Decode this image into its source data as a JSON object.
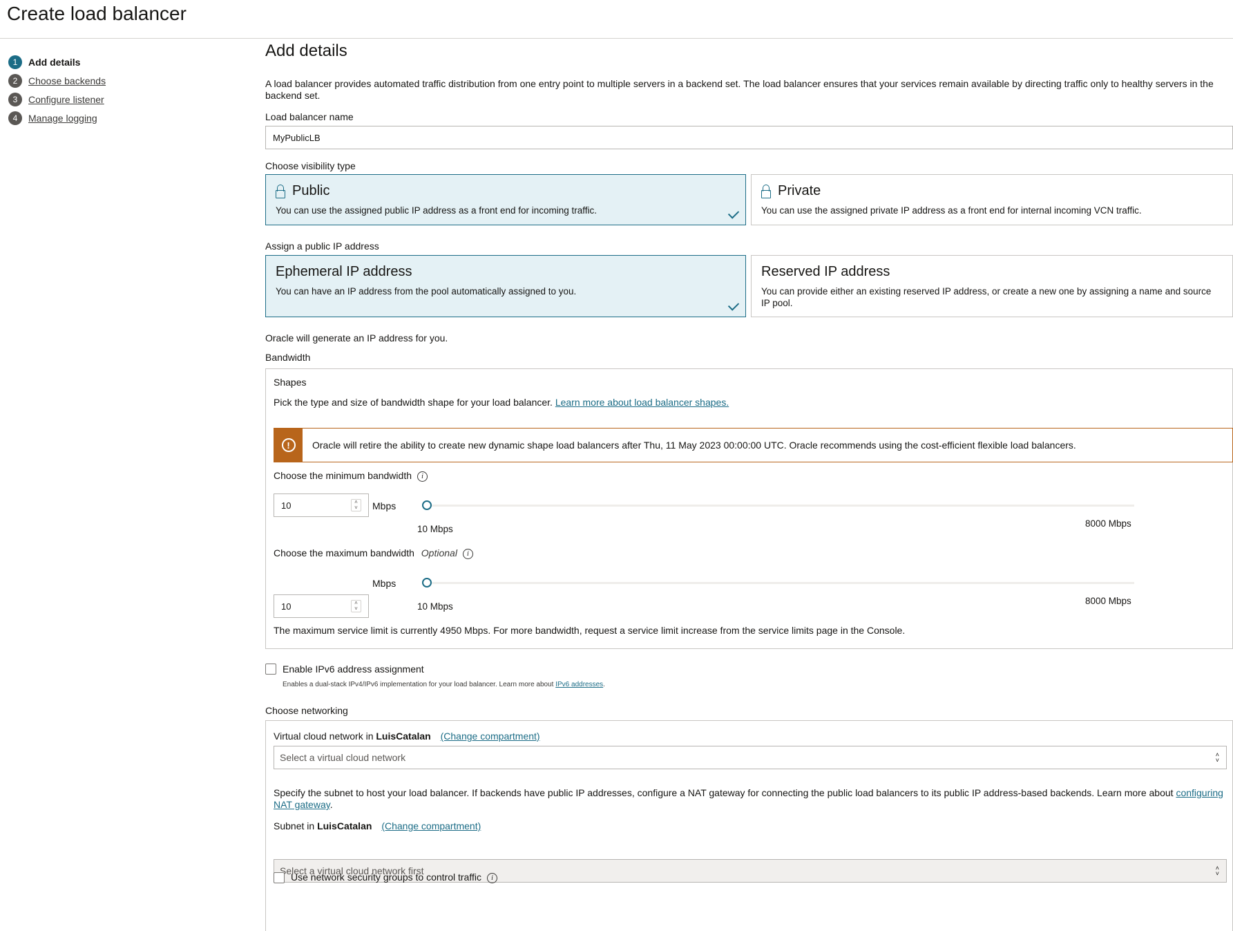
{
  "page": {
    "title": "Create load balancer"
  },
  "steps": [
    {
      "num": "1",
      "label": "Add details"
    },
    {
      "num": "2",
      "label": "Choose backends"
    },
    {
      "num": "3",
      "label": "Configure listener"
    },
    {
      "num": "4",
      "label": "Manage logging"
    }
  ],
  "details": {
    "heading": "Add details",
    "description": "A load balancer provides automated traffic distribution from one entry point to multiple servers in a backend set. The load balancer ensures that your services remain available by directing traffic only to healthy servers in the backend set.",
    "name_label": "Load balancer name",
    "name_value": "MyPublicLB"
  },
  "visibility": {
    "label": "Choose visibility type",
    "public": {
      "title": "Public",
      "desc": "You can use the assigned public IP address as a front end for incoming traffic."
    },
    "private": {
      "title": "Private",
      "desc": "You can use the assigned private IP address as a front end for internal incoming VCN traffic."
    }
  },
  "ip": {
    "label": "Assign a public IP address",
    "ephemeral": {
      "title": "Ephemeral IP address",
      "desc": "You can have an IP address from the pool automatically assigned to you."
    },
    "reserved": {
      "title": "Reserved IP address",
      "desc": "You can provide either an existing reserved IP address, or create a new one by assigning a name and source IP pool."
    },
    "note": "Oracle will generate an IP address for you."
  },
  "bandwidth": {
    "label": "Bandwidth",
    "shapes_title": "Shapes",
    "shapes_desc": "Pick the type and size of bandwidth shape for your load balancer.",
    "shapes_link": "Learn more about load balancer shapes.",
    "warning": "Oracle will retire the ability to create new dynamic shape load balancers after Thu, 11 May 2023 00:00:00 UTC. Oracle recommends using the cost-efficient flexible load balancers.",
    "min_label": "Choose the minimum bandwidth",
    "max_label": "Choose the maximum bandwidth",
    "optional": "Optional",
    "min_value": "10",
    "max_value": "10",
    "unit": "Mbps",
    "range_min": "10 Mbps",
    "range_max": "8000 Mbps",
    "limit_note": "The maximum service limit is currently 4950 Mbps. For more bandwidth, request a service limit increase from the service limits page in the Console."
  },
  "ipv6": {
    "label": "Enable IPv6 address assignment",
    "help_prefix": "Enables a dual-stack IPv4/IPv6 implementation for your load balancer. Learn more about",
    "help_link": "IPv6 addresses",
    "help_suffix": "."
  },
  "networking": {
    "label": "Choose networking",
    "vcn_label_prefix": "Virtual cloud network in",
    "compartment": "LuisCatalan",
    "change_compartment": "(Change compartment)",
    "vcn_placeholder": "Select a virtual cloud network",
    "subnet_desc": "Specify the subnet to host your load balancer. If backends have public IP addresses, configure a NAT gateway for connecting the public load balancers to its public IP address-based backends. Learn more about",
    "subnet_desc_link": "configuring NAT gateway",
    "subnet_desc_suffix": ".",
    "subnet_label_prefix": "Subnet in",
    "subnet_placeholder": "Select a virtual cloud network first",
    "nsg_label": "Use network security groups to control traffic"
  }
}
